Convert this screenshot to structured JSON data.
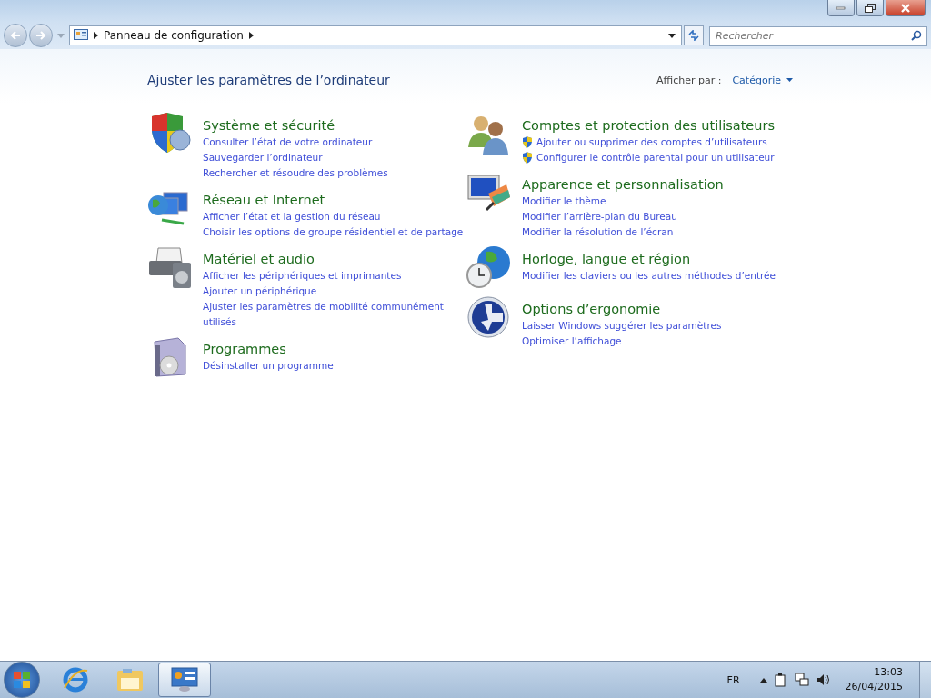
{
  "address_bar": {
    "path": "Panneau de configuration"
  },
  "search": {
    "placeholder": "Rechercher"
  },
  "heading": "Ajuster les paramètres de l’ordinateur",
  "view_by": {
    "label": "Afficher par :",
    "value": "Catégorie"
  },
  "columns": [
    {
      "categories": [
        {
          "kind": "security",
          "title": "Système et sécurité",
          "links": [
            {
              "text": "Consulter l’état de votre ordinateur",
              "shield": false
            },
            {
              "text": "Sauvegarder l’ordinateur",
              "shield": false
            },
            {
              "text": "Rechercher et résoudre des problèmes",
              "shield": false
            }
          ]
        },
        {
          "kind": "network",
          "title": "Réseau et Internet",
          "links": [
            {
              "text": "Afficher l’état et la gestion du réseau",
              "shield": false
            },
            {
              "text": "Choisir les options de groupe résidentiel et de partage",
              "shield": false
            }
          ]
        },
        {
          "kind": "hardware",
          "title": "Matériel et audio",
          "links": [
            {
              "text": "Afficher les périphériques et imprimantes",
              "shield": false
            },
            {
              "text": "Ajouter un périphérique",
              "shield": false
            },
            {
              "text": "Ajuster les paramètres de mobilité communément utilisés",
              "shield": false
            }
          ]
        },
        {
          "kind": "programs",
          "title": "Programmes",
          "links": [
            {
              "text": "Désinstaller un programme",
              "shield": false
            }
          ]
        }
      ]
    },
    {
      "categories": [
        {
          "kind": "users",
          "title": "Comptes et protection des utilisateurs",
          "links": [
            {
              "text": "Ajouter ou supprimer des comptes d’utilisateurs",
              "shield": true
            },
            {
              "text": "Configurer le contrôle parental pour un utilisateur",
              "shield": true
            }
          ]
        },
        {
          "kind": "appearance",
          "title": "Apparence et personnalisation",
          "links": [
            {
              "text": "Modifier le thème",
              "shield": false
            },
            {
              "text": "Modifier l’arrière-plan du Bureau",
              "shield": false
            },
            {
              "text": "Modifier la résolution de l’écran",
              "shield": false
            }
          ]
        },
        {
          "kind": "clock",
          "title": "Horloge, langue et région",
          "links": [
            {
              "text": "Modifier les claviers ou les autres méthodes d’entrée",
              "shield": false
            }
          ]
        },
        {
          "kind": "access",
          "title": "Options d’ergonomie",
          "links": [
            {
              "text": "Laisser Windows suggérer les paramètres",
              "shield": false
            },
            {
              "text": "Optimiser l’affichage",
              "shield": false
            }
          ]
        }
      ]
    }
  ],
  "taskbar": {
    "items": [
      {
        "kind": "ie",
        "selected": false
      },
      {
        "kind": "explorer",
        "selected": false
      },
      {
        "kind": "control",
        "selected": true
      }
    ],
    "language": "FR",
    "time": "13:03",
    "date": "26/04/2015"
  }
}
